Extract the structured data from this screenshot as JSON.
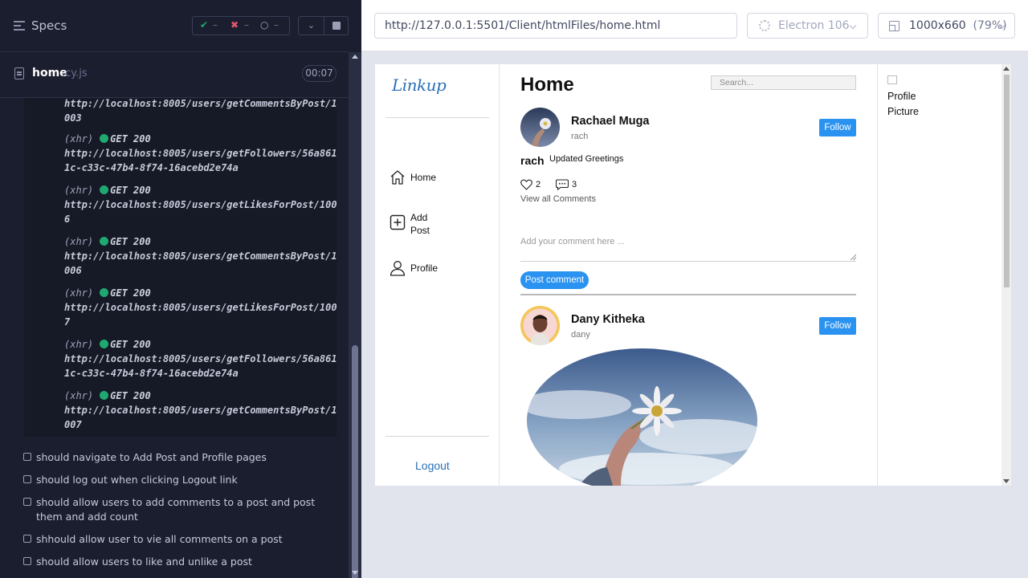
{
  "runner": {
    "title": "Specs",
    "stats": {
      "passed": "–",
      "failed": "–",
      "pending": "–"
    },
    "spec_file": {
      "name": "home",
      "ext": ".cy.js",
      "duration": "00:07"
    },
    "log": {
      "partial_url": "http://localhost:8005/users/getCommentsByPost/1003",
      "entries": [
        {
          "type": "(xhr)",
          "method": "GET 200",
          "url": "http://localhost:8005/users/getFollowers/56a8611c-c33c-47b4-8f74-16acebd2e74a"
        },
        {
          "type": "(xhr)",
          "method": "GET 200",
          "url": "http://localhost:8005/users/getLikesForPost/1006"
        },
        {
          "type": "(xhr)",
          "method": "GET 200",
          "url": "http://localhost:8005/users/getCommentsByPost/1006"
        },
        {
          "type": "(xhr)",
          "method": "GET 200",
          "url": "http://localhost:8005/users/getLikesForPost/1007"
        },
        {
          "type": "(xhr)",
          "method": "GET 200",
          "url": "http://localhost:8005/users/getFollowers/56a8611c-c33c-47b4-8f74-16acebd2e74a"
        },
        {
          "type": "(xhr)",
          "method": "GET 200",
          "url": "http://localhost:8005/users/getCommentsByPost/1007"
        }
      ]
    },
    "tests": [
      "should navigate to Add Post and Profile pages",
      "should log out when clicking Logout link",
      "should allow users to add comments to a post and post them and add count",
      "shhould allow user to vie all comments on a post",
      "should allow users to like and unlike a post"
    ]
  },
  "aut": {
    "url": "http://127.0.0.1:5501/Client/htmlFiles/home.html",
    "browser": "Electron 106",
    "viewport": "1000x660",
    "zoom": "(79%)"
  },
  "app": {
    "logo": "Linkup",
    "nav": {
      "home": "Home",
      "add_post": "Add Post",
      "profile": "Profile"
    },
    "logout": "Logout",
    "page_title": "Home",
    "search_placeholder": "Search...",
    "posts": [
      {
        "name": "Rachael Muga",
        "handle": "rach",
        "follow": "Follow",
        "caption_user": "rach",
        "caption": "Updated Greetings",
        "likes": "2",
        "comments": "3",
        "view_all": "View all Comments",
        "comment_placeholder": "Add your comment here ...",
        "post_comment": "Post comment"
      },
      {
        "name": "Dany Kitheka",
        "handle": "dany",
        "follow": "Follow"
      }
    ],
    "profile_picture_alt": "Profile Picture"
  },
  "colors": {
    "accent": "#2a92f0",
    "pass": "#1fa971",
    "fail": "#e45770",
    "runner_bg": "#1b1e2e"
  }
}
